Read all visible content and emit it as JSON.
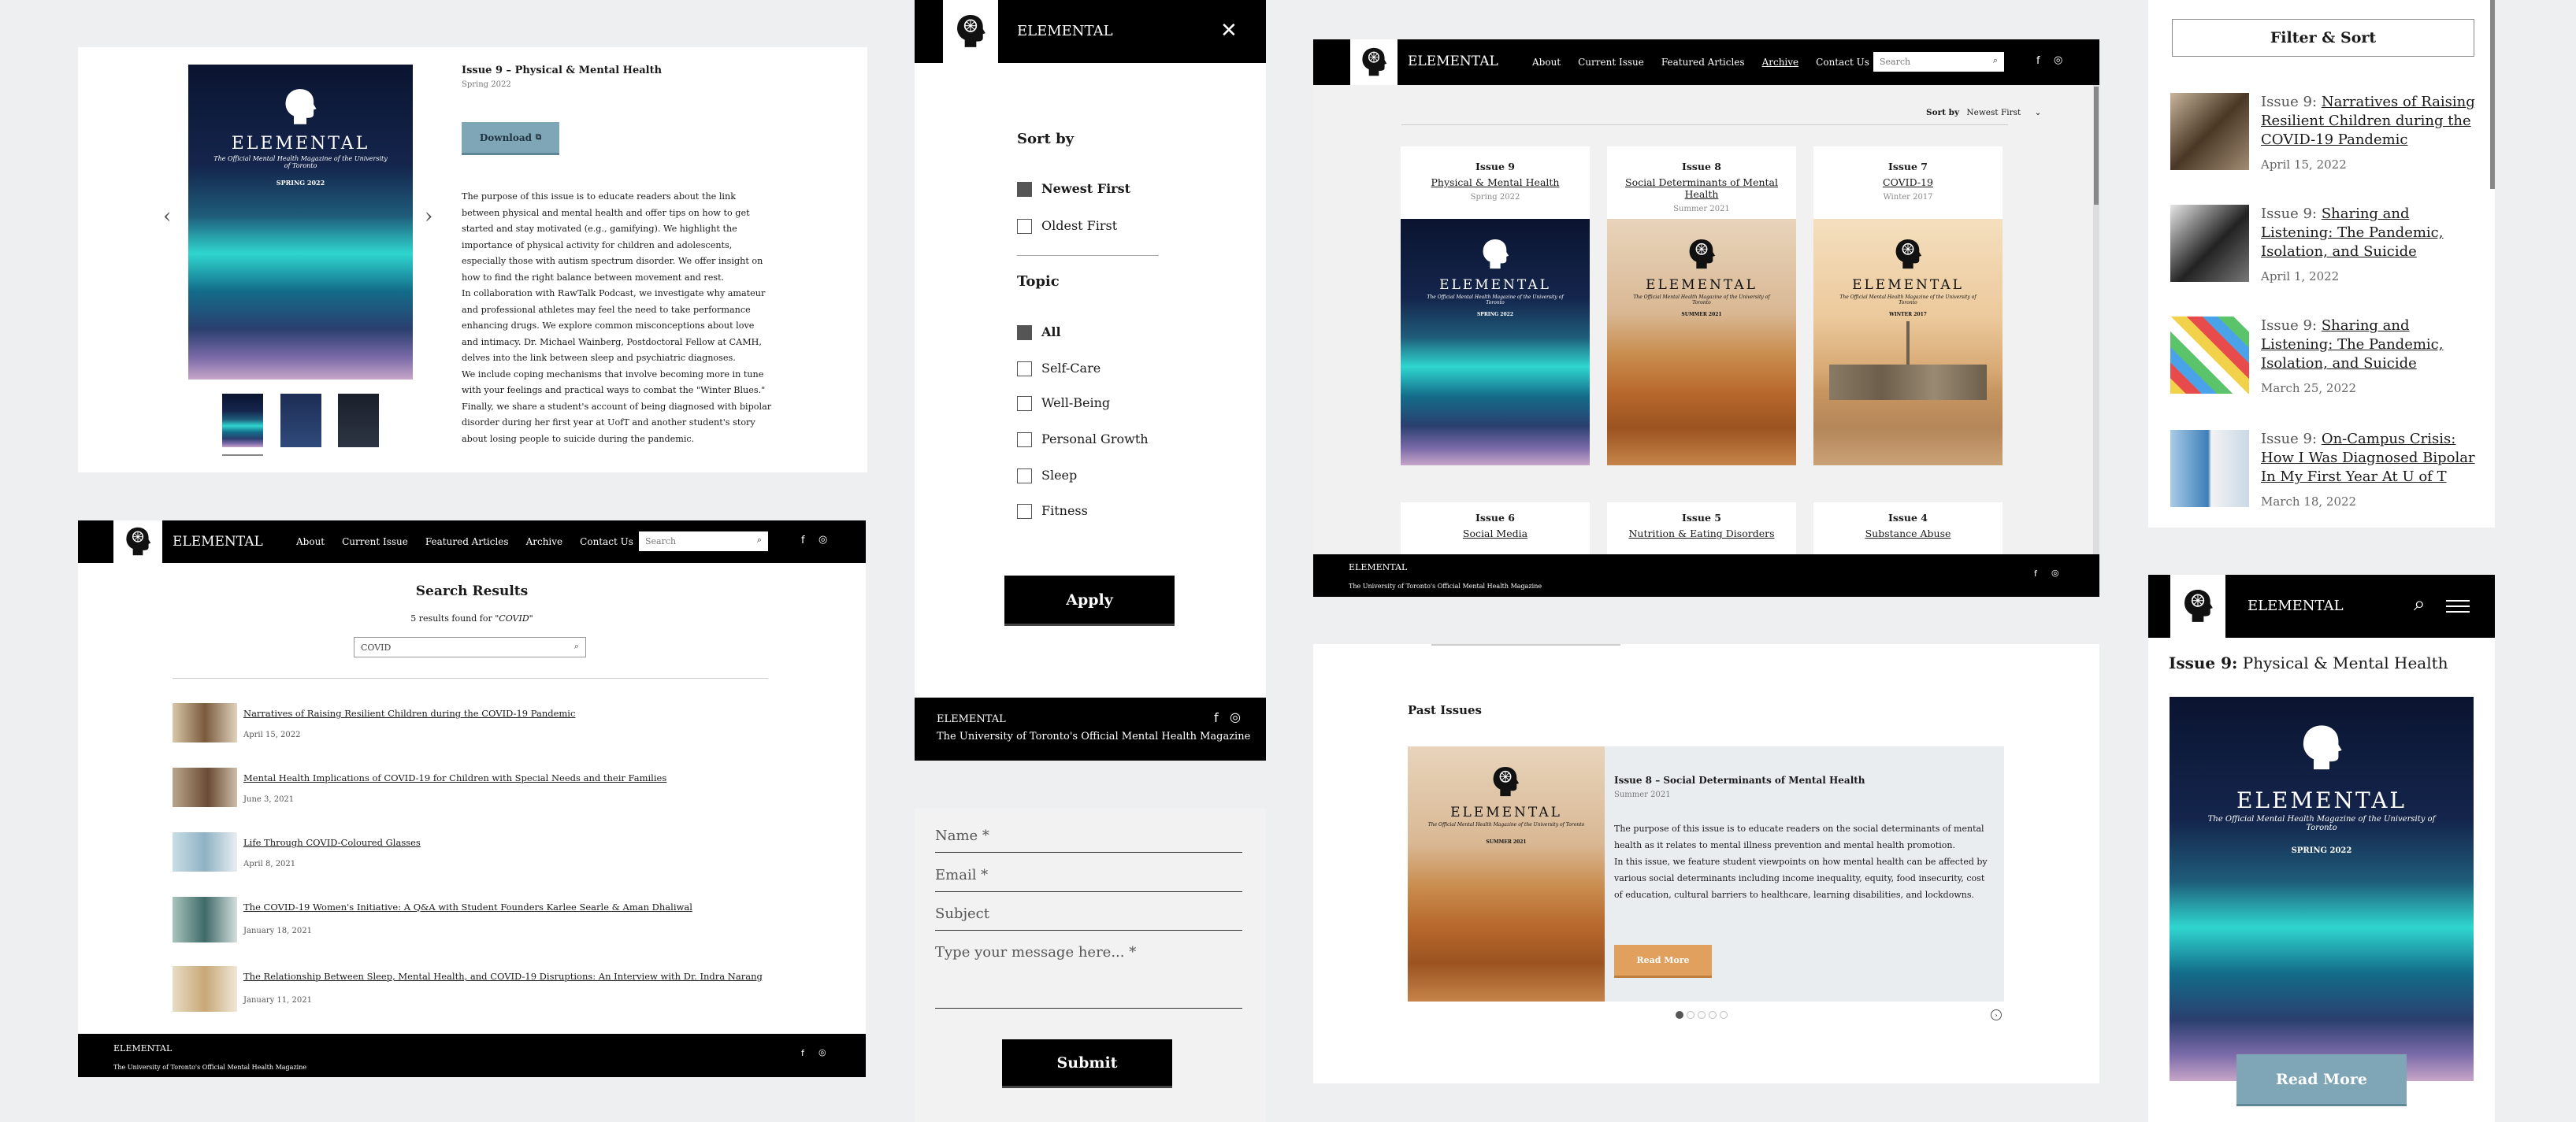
{
  "brand": "ELEMENTAL",
  "brand_tagline": "The University of Toronto's Official Mental Health Magazine",
  "cover": {
    "title": "ELEMENTAL",
    "subtitle": "The Official Mental Health Magazine of the University of Toronto",
    "spring": "SPRING 2022",
    "summer": "SUMMER 2021",
    "winter": "WINTER 2017"
  },
  "issue_detail": {
    "title": "Issue 9 – Physical & Mental Health",
    "date": "Spring 2022",
    "download": "Download",
    "paragraphs": [
      "The purpose of this issue is to educate readers about the link between physical and mental health and offer tips on how to get started and stay motivated (e.g., gamifying). We highlight the importance of physical activity for children and adolescents, especially those with autism spectrum disorder. We offer insight on how to find the right balance between movement and rest.",
      "In collaboration with RawTalk Podcast, we investigate why amateur and professional athletes may feel the need to take performance enhancing drugs. We explore common misconceptions about love and intimacy. Dr. Michael Wainberg, Postdoctoral Fellow at CAMH, delves into the link between sleep and psychiatric diagnoses.",
      "We include coping mechanisms that involve becoming more in tune with your feelings and practical ways to combat the \"Winter Blues.\"",
      "Finally, we share a student's account of being diagnosed with bipolar disorder during her first year at UofT and another student's story about losing people to suicide during the pandemic."
    ]
  },
  "nav": {
    "links": [
      "About",
      "Current Issue",
      "Featured Articles",
      "Archive",
      "Contact Us"
    ],
    "search_placeholder": "Search",
    "facebook": "f",
    "instagram": "◎"
  },
  "search_results": {
    "title": "Search Results",
    "count_text": "5 results found for",
    "query_display": "\"COVID\"",
    "query": "COVID",
    "items": [
      {
        "title": "Narratives of Raising Resilient Children during the COVID-19 Pandemic",
        "date": "April 15, 2022"
      },
      {
        "title": "Mental Health Implications of COVID-19 for Children with Special Needs and their Families",
        "date": "June 3, 2021"
      },
      {
        "title": "Life Through COVID-Coloured Glasses",
        "date": "April 8, 2021"
      },
      {
        "title": "The COVID-19 Women's Initiative: A Q&A with Student Founders Karlee Searle & Aman Dhaliwal",
        "date": "January 18, 2021"
      },
      {
        "title": "The Relationship Between Sleep, Mental Health, and COVID-19 Disruptions: An Interview with Dr. Indra Narang",
        "date": "January 11, 2021"
      }
    ]
  },
  "filter_panel": {
    "close": "✕",
    "sort_heading": "Sort by",
    "sort_options": [
      "Newest First",
      "Oldest First"
    ],
    "topic_heading": "Topic",
    "topic_options": [
      "All",
      "Self-Care",
      "Well-Being",
      "Personal Growth",
      "Sleep",
      "Fitness"
    ],
    "apply": "Apply"
  },
  "contact_form": {
    "name": "Name *",
    "email": "Email *",
    "subject": "Subject",
    "message": "Type your message here... *",
    "submit": "Submit"
  },
  "archive": {
    "sort_label": "Sort by",
    "sort_value": "Newest First",
    "issues": [
      {
        "number": "Issue 9",
        "topic": "Physical & Mental Health",
        "season": "Spring 2022"
      },
      {
        "number": "Issue 8",
        "topic": "Social Determinants of Mental Health",
        "season": "Summer 2021"
      },
      {
        "number": "Issue 7",
        "topic": "COVID-19",
        "season": "Winter 2017"
      },
      {
        "number": "Issue 6",
        "topic": "Social Media"
      },
      {
        "number": "Issue 5",
        "topic": "Nutrition & Eating Disorders"
      },
      {
        "number": "Issue 4",
        "topic": "Substance Abuse"
      }
    ]
  },
  "past_issues": {
    "heading": "Past Issues",
    "title": "Issue 8 – Social Determinants of Mental Health",
    "date": "Summer 2021",
    "paragraphs": [
      "The purpose of this issue is to educate readers on the social determinants of mental health as it relates to mental illness prevention and mental health promotion.",
      "In this issue, we feature student viewpoints on how mental health can be affected by various social determinants including income inequality, equity, food insecurity, cost of education, cultural barriers to healthcare, learning disabilities, and lockdowns."
    ],
    "read_more": "Read More"
  },
  "filter_sort": {
    "button": "Filter & Sort",
    "articles": [
      {
        "issue": "Issue 9:",
        "title": "Narratives of Raising Resilient Children during the COVID-19 Pandemic",
        "date": "April 15, 2022"
      },
      {
        "issue": "Issue 9:",
        "title": "Sharing and Listening: The Pandemic, Isolation, and Suicide",
        "date": "April 1, 2022"
      },
      {
        "issue": "Issue 9:",
        "title": "Sharing and Listening: The Pandemic, Isolation, and Suicide",
        "date": "March 25, 2022"
      },
      {
        "issue": "Issue 9:",
        "title": "On-Campus Crisis: How I Was Diagnosed Bipolar In My First Year At U of T",
        "date": "March 18, 2022"
      }
    ]
  },
  "mobile": {
    "issue_label": "Issue 9:",
    "issue_topic": "Physical & Mental Health",
    "read_more": "Read More"
  },
  "colors": {
    "accent_teal": "#7ea6b6",
    "accent_orange": "#e1a05e",
    "panel_gray": "#eaedf0"
  }
}
